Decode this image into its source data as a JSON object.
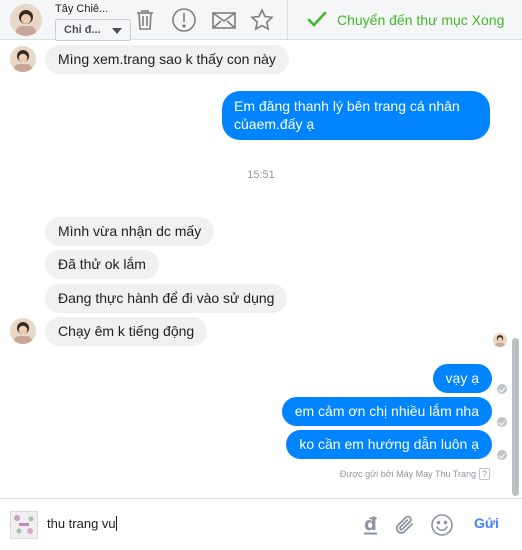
{
  "header": {
    "contact_name": "Tây Chiê...",
    "dropdown_label": "Chỉ đ...",
    "done_label": "Chuyển đến thư mục Xong",
    "icons": [
      "trash-icon",
      "spam-warning-icon",
      "mail-icon",
      "star-icon",
      "checkmark-icon"
    ],
    "accent_color": "#42b72a"
  },
  "messages": {
    "m1": "Mìng xem.trang sao k thấy con này",
    "m2_line1": "Em đăng thanh lý bên trang cá nhân",
    "m2_line2": "củaem.đấy ạ",
    "time": "15:51",
    "m3": "Mình vừa nhận dc mấy",
    "m4": "Đã thử ok lắm",
    "m5": "Đang thực hành để đi vào sử dụng",
    "m6": "Chạy êm k tiếng động",
    "m7": "vạy ạ",
    "m8": "em cảm ơn chị nhiều lắm nha",
    "m9": "ko cần em hướng dẫn luôn ạ",
    "sent_by": "Được gửi bởi Máy May Thu Trang",
    "sent_by_help": "?",
    "colors": {
      "outgoing": "#0084ff",
      "incoming": "#f1f0f0"
    }
  },
  "composer": {
    "value": "thu trang vu",
    "send_label": "Gửi",
    "icons": [
      "currency-dong-icon",
      "attachment-icon",
      "emoji-icon"
    ]
  }
}
